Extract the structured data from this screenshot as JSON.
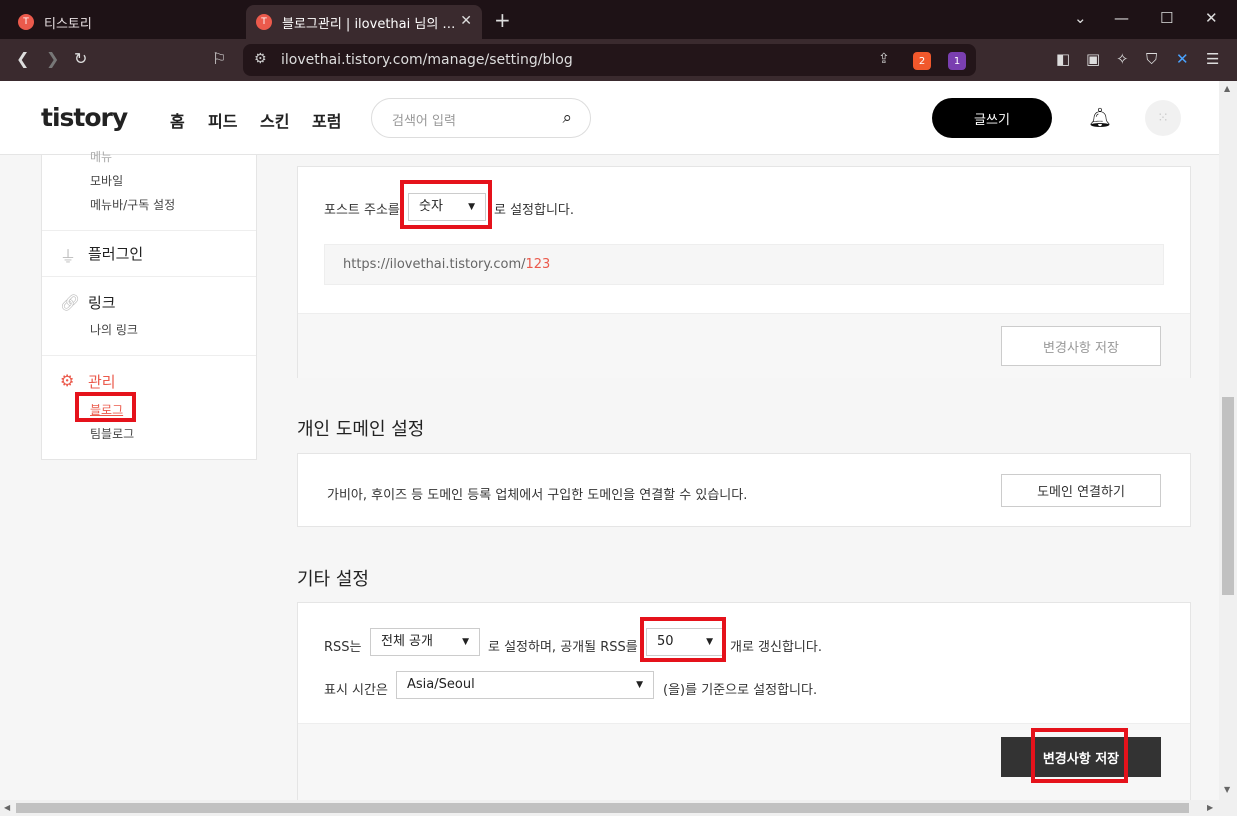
{
  "browser": {
    "tabs": [
      {
        "label": "티스토리"
      },
      {
        "label": "블로그관리 | ilovethai 님의 블로그"
      }
    ],
    "url": "ilovethai.tistory.com/manage/setting/blog",
    "brave_badge": "2",
    "alert_badge": "1"
  },
  "header": {
    "logo": "tistory",
    "nav": [
      "홈",
      "피드",
      "스킨",
      "포럼"
    ],
    "search_placeholder": "검색어 입력",
    "write_label": "글쓰기"
  },
  "sidebar": {
    "menu_cut": "메뉴",
    "menu_sub": [
      "모바일",
      "메뉴바/구독 설정"
    ],
    "plugin": "플러그인",
    "link": "링크",
    "link_sub": "나의 링크",
    "manage": "관리",
    "manage_sub": [
      "블로그",
      "팀블로그"
    ]
  },
  "post_address": {
    "prefix": "포스트 주소를",
    "selected": "숫자",
    "suffix": "로 설정합니다.",
    "example_url": "https://ilovethai.tistory.com/",
    "example_num": "123",
    "save_label": "변경사항 저장"
  },
  "domain": {
    "title": "개인 도메인 설정",
    "desc": "가비아, 후이즈 등 도메인 등록 업체에서 구입한 도메인을 연결할 수 있습니다.",
    "button": "도메인 연결하기"
  },
  "other": {
    "title": "기타 설정",
    "rss_prefix": "RSS는",
    "rss_select": "전체 공개",
    "rss_mid": "로 설정하며, 공개될 RSS를",
    "rss_count": "50",
    "rss_suffix": "개로 갱신합니다.",
    "time_prefix": "표시 시간은",
    "timezone": "Asia/Seoul",
    "time_suffix": "(을)를 기준으로 설정합니다.",
    "save_label": "변경사항 저장"
  },
  "colors": {
    "accent": "#eb5a4c",
    "highlight": "#e5121b"
  }
}
